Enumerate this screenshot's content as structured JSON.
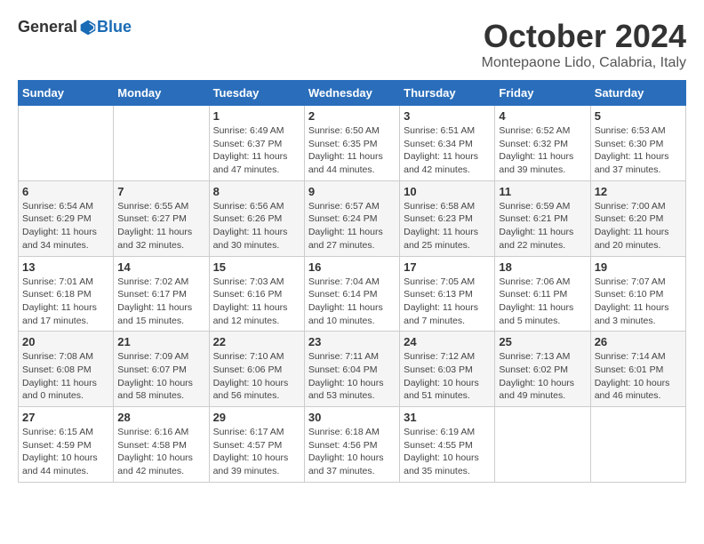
{
  "header": {
    "logo_general": "General",
    "logo_blue": "Blue",
    "month": "October 2024",
    "location": "Montepaone Lido, Calabria, Italy"
  },
  "days_of_week": [
    "Sunday",
    "Monday",
    "Tuesday",
    "Wednesday",
    "Thursday",
    "Friday",
    "Saturday"
  ],
  "weeks": [
    [
      {
        "day": "",
        "info": ""
      },
      {
        "day": "",
        "info": ""
      },
      {
        "day": "1",
        "info": "Sunrise: 6:49 AM\nSunset: 6:37 PM\nDaylight: 11 hours and 47 minutes."
      },
      {
        "day": "2",
        "info": "Sunrise: 6:50 AM\nSunset: 6:35 PM\nDaylight: 11 hours and 44 minutes."
      },
      {
        "day": "3",
        "info": "Sunrise: 6:51 AM\nSunset: 6:34 PM\nDaylight: 11 hours and 42 minutes."
      },
      {
        "day": "4",
        "info": "Sunrise: 6:52 AM\nSunset: 6:32 PM\nDaylight: 11 hours and 39 minutes."
      },
      {
        "day": "5",
        "info": "Sunrise: 6:53 AM\nSunset: 6:30 PM\nDaylight: 11 hours and 37 minutes."
      }
    ],
    [
      {
        "day": "6",
        "info": "Sunrise: 6:54 AM\nSunset: 6:29 PM\nDaylight: 11 hours and 34 minutes."
      },
      {
        "day": "7",
        "info": "Sunrise: 6:55 AM\nSunset: 6:27 PM\nDaylight: 11 hours and 32 minutes."
      },
      {
        "day": "8",
        "info": "Sunrise: 6:56 AM\nSunset: 6:26 PM\nDaylight: 11 hours and 30 minutes."
      },
      {
        "day": "9",
        "info": "Sunrise: 6:57 AM\nSunset: 6:24 PM\nDaylight: 11 hours and 27 minutes."
      },
      {
        "day": "10",
        "info": "Sunrise: 6:58 AM\nSunset: 6:23 PM\nDaylight: 11 hours and 25 minutes."
      },
      {
        "day": "11",
        "info": "Sunrise: 6:59 AM\nSunset: 6:21 PM\nDaylight: 11 hours and 22 minutes."
      },
      {
        "day": "12",
        "info": "Sunrise: 7:00 AM\nSunset: 6:20 PM\nDaylight: 11 hours and 20 minutes."
      }
    ],
    [
      {
        "day": "13",
        "info": "Sunrise: 7:01 AM\nSunset: 6:18 PM\nDaylight: 11 hours and 17 minutes."
      },
      {
        "day": "14",
        "info": "Sunrise: 7:02 AM\nSunset: 6:17 PM\nDaylight: 11 hours and 15 minutes."
      },
      {
        "day": "15",
        "info": "Sunrise: 7:03 AM\nSunset: 6:16 PM\nDaylight: 11 hours and 12 minutes."
      },
      {
        "day": "16",
        "info": "Sunrise: 7:04 AM\nSunset: 6:14 PM\nDaylight: 11 hours and 10 minutes."
      },
      {
        "day": "17",
        "info": "Sunrise: 7:05 AM\nSunset: 6:13 PM\nDaylight: 11 hours and 7 minutes."
      },
      {
        "day": "18",
        "info": "Sunrise: 7:06 AM\nSunset: 6:11 PM\nDaylight: 11 hours and 5 minutes."
      },
      {
        "day": "19",
        "info": "Sunrise: 7:07 AM\nSunset: 6:10 PM\nDaylight: 11 hours and 3 minutes."
      }
    ],
    [
      {
        "day": "20",
        "info": "Sunrise: 7:08 AM\nSunset: 6:08 PM\nDaylight: 11 hours and 0 minutes."
      },
      {
        "day": "21",
        "info": "Sunrise: 7:09 AM\nSunset: 6:07 PM\nDaylight: 10 hours and 58 minutes."
      },
      {
        "day": "22",
        "info": "Sunrise: 7:10 AM\nSunset: 6:06 PM\nDaylight: 10 hours and 56 minutes."
      },
      {
        "day": "23",
        "info": "Sunrise: 7:11 AM\nSunset: 6:04 PM\nDaylight: 10 hours and 53 minutes."
      },
      {
        "day": "24",
        "info": "Sunrise: 7:12 AM\nSunset: 6:03 PM\nDaylight: 10 hours and 51 minutes."
      },
      {
        "day": "25",
        "info": "Sunrise: 7:13 AM\nSunset: 6:02 PM\nDaylight: 10 hours and 49 minutes."
      },
      {
        "day": "26",
        "info": "Sunrise: 7:14 AM\nSunset: 6:01 PM\nDaylight: 10 hours and 46 minutes."
      }
    ],
    [
      {
        "day": "27",
        "info": "Sunrise: 6:15 AM\nSunset: 4:59 PM\nDaylight: 10 hours and 44 minutes."
      },
      {
        "day": "28",
        "info": "Sunrise: 6:16 AM\nSunset: 4:58 PM\nDaylight: 10 hours and 42 minutes."
      },
      {
        "day": "29",
        "info": "Sunrise: 6:17 AM\nSunset: 4:57 PM\nDaylight: 10 hours and 39 minutes."
      },
      {
        "day": "30",
        "info": "Sunrise: 6:18 AM\nSunset: 4:56 PM\nDaylight: 10 hours and 37 minutes."
      },
      {
        "day": "31",
        "info": "Sunrise: 6:19 AM\nSunset: 4:55 PM\nDaylight: 10 hours and 35 minutes."
      },
      {
        "day": "",
        "info": ""
      },
      {
        "day": "",
        "info": ""
      }
    ]
  ]
}
